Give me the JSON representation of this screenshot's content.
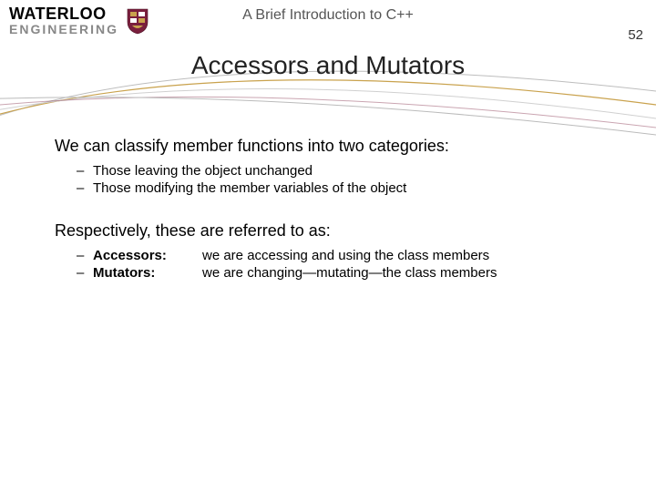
{
  "logo": {
    "line1": "WATERLOO",
    "line2": "ENGINEERING"
  },
  "header": {
    "doc_title": "A Brief Introduction to C++",
    "page_number": "52"
  },
  "title": "Accessors and Mutators",
  "content": {
    "para1": "We can classify member functions into two categories:",
    "list1": {
      "item1": "Those leaving the object unchanged",
      "item2": "Those modifying the member variables of the object"
    },
    "para2": "Respectively, these are referred to as:",
    "list2": {
      "item1_term": "Accessors:",
      "item1_desc": "we are accessing and using the class members",
      "item2_term": "Mutators:",
      "item2_desc": "we are changing—mutating—the class members"
    }
  },
  "dash": "–"
}
